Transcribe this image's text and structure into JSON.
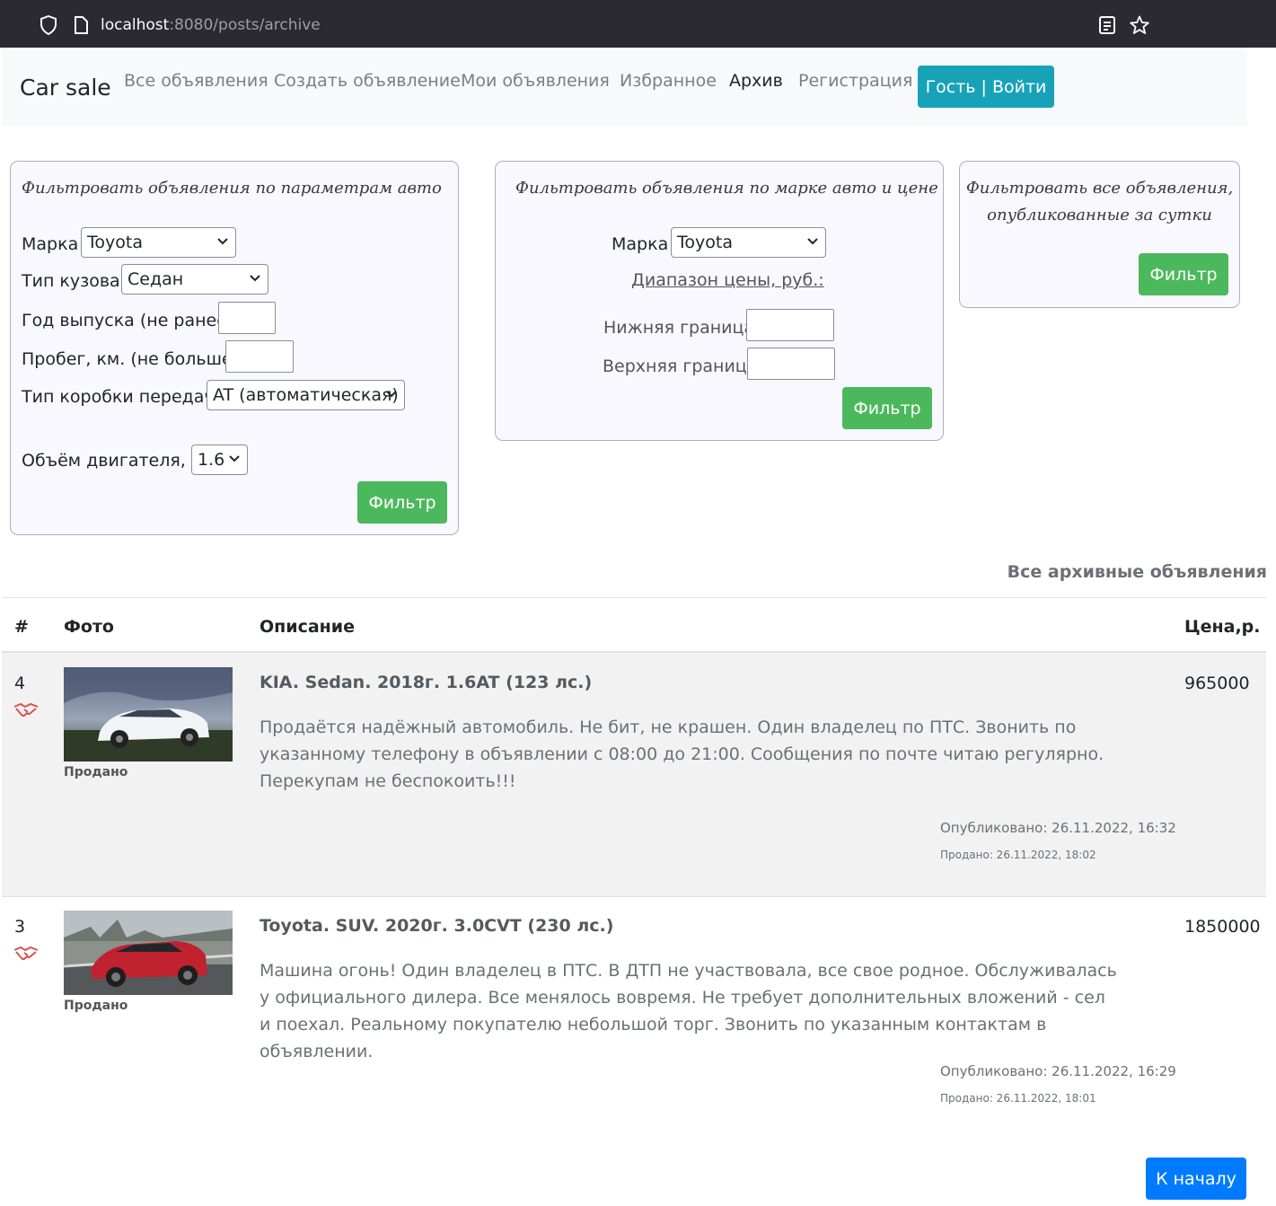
{
  "browser": {
    "url_host": "localhost",
    "url_rest": ":8080/posts/archive"
  },
  "navbar": {
    "brand": "Car sale",
    "links": [
      "Все объявления",
      "Создать объявление",
      "Мои объявления",
      "Избранное",
      "Архив",
      "Регистрация"
    ],
    "login_button": "Гость | Войти"
  },
  "filter_params": {
    "title": "Фильтровать объявления по параметрам авто",
    "brand_label": "Марка",
    "brand_value": "Toyota",
    "body_label": "Тип кузова:",
    "body_value": "Седан",
    "year_label": "Год выпуска (не ранее)",
    "mileage_label": "Пробег, км. (не больше)",
    "gearbox_label": "Тип коробки передач",
    "gearbox_value": "AT (автоматическая)",
    "engine_label": "Объём двигателя, л.",
    "engine_value": "1.6",
    "button": "Фильтр"
  },
  "filter_price": {
    "title": "Фильтровать объявления по марке авто и цене",
    "brand_label": "Марка",
    "brand_value": "Toyota",
    "range_label": "Диапазон цены, руб.:",
    "min_label": "Нижняя граница",
    "max_label": "Верхняя граница",
    "button": "Фильтр"
  },
  "filter_day": {
    "title_line1": "Фильтровать все объявления,",
    "title_line2": "опубликованные за сутки",
    "button": "Фильтр"
  },
  "archive": {
    "title": "Все архивные объявления",
    "headers": [
      "#",
      "Фото",
      "Описание",
      "Цена,р."
    ],
    "rows": [
      {
        "num": "4",
        "sold_label": "Продано",
        "title": "KIA. Sedan. 2018г. 1.6AT (123 лс.)",
        "description": "Продаётся надёжный автомобиль. Не бит, не крашен. Один владелец по ПТС. Звонить по указанному телефону в объявлении с 08:00 до 21:00. Сообщения по почте читаю регулярно. Перекупам не беспокоить!!!",
        "published": "Опубликовано: 26.11.2022, 16:32",
        "sold": "Продано: 26.11.2022, 18:02",
        "price": "965000"
      },
      {
        "num": "3",
        "sold_label": "Продано",
        "title": "Toyota. SUV. 2020г. 3.0CVT (230 лс.)",
        "description": "Машина огонь! Один владелец в ПТС. В ДТП не участвовала, все свое родное. Обслуживалась у официального дилера. Все менялось вовремя. Не требует дополнительных вложений - сел и поехал. Реальному покупателю небольшой торг. Звонить по указанным контактам в объявлении.",
        "published": "Опубликовано: 26.11.2022, 16:29",
        "sold": "Продано: 26.11.2022, 18:01",
        "price": "1850000"
      }
    ]
  },
  "top_button": "К началу",
  "colors": {
    "info": "#17a2b8",
    "success": "#4cb85c",
    "primary": "#007bff",
    "deal_icon": "#d9534f"
  }
}
